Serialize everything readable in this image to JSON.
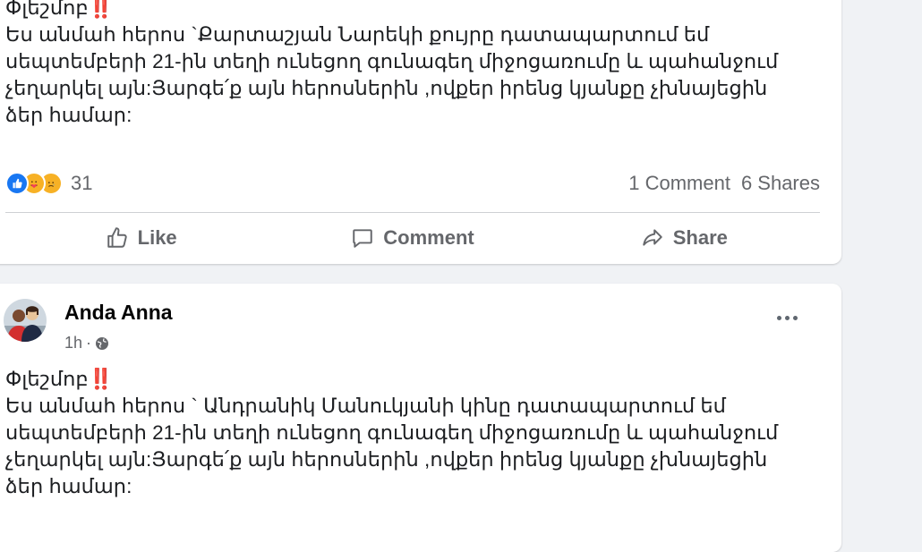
{
  "post1": {
    "text_head": "Փլեշմոբ",
    "text_bang": "‼️",
    "text_body": "Ես անմահ  հերոս `Քարտաշյան Նարեկի քույրը դատապարտում եմ\nսեպտեմբերի 21-ին տեղի ունեցող գունագեղ միջոցառումը և պահանջում\nչեղարկել այն:Յարգե՛ք այն հերոսներին ,ովքեր իրենց կյանքը չխնայեցին\nձեր համար:",
    "reaction_count": "31",
    "comments": "1 Comment",
    "shares": "6 Shares",
    "actions": {
      "like": "Like",
      "comment": "Comment",
      "share": "Share"
    }
  },
  "post2": {
    "author": "Anda Anna",
    "time": "1h",
    "time_sep": "·",
    "text_head": "Փլեշմոբ",
    "text_bang": "‼️",
    "text_body": "Ես անմահ  հերոս `  Անդրանիկ Մանուկյանի կինը դատապարտում եմ\nսեպտեմբերի 21-ին տեղի ունեցող գունագեղ միջոցառումը և պահանջում\nչեղարկել այն:Յարգե՛ք այն հերոսներին ,ովքեր իրենց կյանքը չխնայեցին\nձեր համար:"
  },
  "icons": {
    "reactions": [
      "like-reaction-icon",
      "care-reaction-icon",
      "sad-reaction-icon"
    ],
    "actions": [
      "thumbs-up-icon",
      "comment-icon",
      "share-arrow-icon"
    ],
    "privacy": "globe-icon",
    "menu": "more-options-icon"
  },
  "colors": {
    "background": "#f0f2f5",
    "card": "#ffffff",
    "secondary_text": "#65676b",
    "like_blue": "#1877f2",
    "reaction_yellow": "#f7b125",
    "exclamation_red": "#e0245e"
  }
}
